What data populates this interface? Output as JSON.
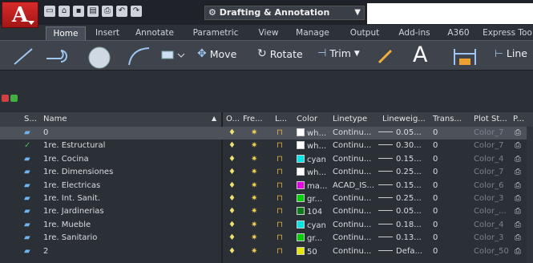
{
  "app": {
    "logo_letter": "A",
    "workspace": "Drafting & Annotation"
  },
  "tabs": [
    "Home",
    "Insert",
    "Annotate",
    "Parametric",
    "View",
    "Manage",
    "Output",
    "Add-ins",
    "A360",
    "Express Too"
  ],
  "ribbon": {
    "move": "Move",
    "rotate": "Rotate",
    "trim": "Trim",
    "text": "A",
    "linear": "Line"
  },
  "layer_headers": [
    "S...",
    "Name",
    "O...",
    "Fre...",
    "L...",
    "Color",
    "Linetype",
    "Lineweig...",
    "Trans...",
    "Plot St...",
    "P..."
  ],
  "layers": [
    {
      "name": "0",
      "color": "wh...",
      "linetype": "Continu...",
      "lineweight": "0.05...",
      "trans": "0",
      "plot": "Color_7",
      "swatch": "#ffffff",
      "selected": true
    },
    {
      "name": "1re. Estructural",
      "color": "wh...",
      "linetype": "Continu...",
      "lineweight": "0.30...",
      "trans": "0",
      "plot": "Color_7",
      "swatch": "#ffffff",
      "selected": false
    },
    {
      "name": "1re. Cocina",
      "color": "cyan",
      "linetype": "Continu...",
      "lineweight": "0.15...",
      "trans": "0",
      "plot": "Color_4",
      "swatch": "#00e5e5",
      "selected": false
    },
    {
      "name": "1re. Dimensiones",
      "color": "wh...",
      "linetype": "Continu...",
      "lineweight": "0.25...",
      "trans": "0",
      "plot": "Color_7",
      "swatch": "#ffffff",
      "selected": false
    },
    {
      "name": "1re. Electricas",
      "color": "ma...",
      "linetype": "ACAD_IS...",
      "lineweight": "0.15...",
      "trans": "0",
      "plot": "Color_6",
      "swatch": "#e600e6",
      "selected": false
    },
    {
      "name": "1re. Int. Sanit.",
      "color": "gr...",
      "linetype": "Continu...",
      "lineweight": "0.25...",
      "trans": "0",
      "plot": "Color_3",
      "swatch": "#00d000",
      "selected": false
    },
    {
      "name": "1re. Jardinerias",
      "color": "104",
      "linetype": "Continu...",
      "lineweight": "0.05...",
      "trans": "0",
      "plot": "Color_...",
      "swatch": "#0f7a1a",
      "selected": false
    },
    {
      "name": "1re. Mueble",
      "color": "cyan",
      "linetype": "Continu...",
      "lineweight": "0.18...",
      "trans": "0",
      "plot": "Color_4",
      "swatch": "#00e5e5",
      "selected": false
    },
    {
      "name": "1re. Sanitario",
      "color": "gr...",
      "linetype": "Continu...",
      "lineweight": "0.13...",
      "trans": "0",
      "plot": "Color_3",
      "swatch": "#00d000",
      "selected": false
    },
    {
      "name": "2",
      "color": "50",
      "linetype": "Continu...",
      "lineweight": "Defa...",
      "trans": "0",
      "plot": "Color_50",
      "swatch": "#e6e600",
      "selected": false
    }
  ]
}
